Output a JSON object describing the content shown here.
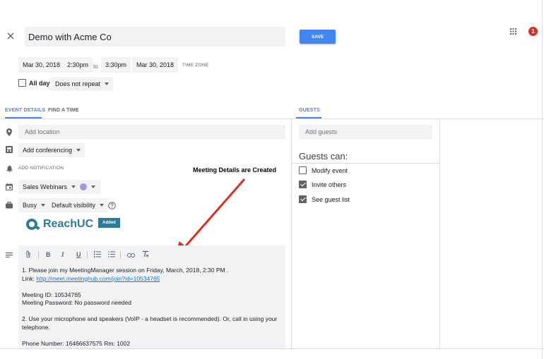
{
  "header": {
    "title": "Demo with Acme Co",
    "save_label": "SAVE",
    "notification_count": "1"
  },
  "datetime": {
    "start_date": "Mar 30, 2018",
    "start_time": "2:30pm",
    "to_label": "to",
    "end_time": "3:30pm",
    "end_date": "Mar 30, 2018",
    "timezone_label": "TIME ZONE",
    "all_day_label": "All day",
    "repeat_value": "Does not repeat"
  },
  "tabs": {
    "event_details": "EVENT DETAILS",
    "find_a_time": "FIND A TIME",
    "guests": "GUESTS"
  },
  "details": {
    "location_placeholder": "Add location",
    "conferencing_label": "Add conferencing",
    "add_notification_label": "ADD NOTIFICATION",
    "calendar_value": "Sales Webinars",
    "color_value": "#a995de",
    "busy_value": "Busy",
    "visibility_value": "Default visibility",
    "addon_name": "ReachUC",
    "addon_status": "Added"
  },
  "annotation": {
    "text": "Meeting Details are Created",
    "arrow_color": "#d93025"
  },
  "description": {
    "line1": "1. Please join my MeetingManager session on Friday, March, 2018, 2:30 PM .",
    "link_label": "Link: ",
    "link_url": "http://meet.meetinghub.com/join?id=10534765",
    "meeting_id": "Meeting ID: 10534765",
    "meeting_password": "Meeting Password: No password needed",
    "line2": "2. Use your microphone and speakers (VoIP - a headset is recommended). Or, call in using your telephone.",
    "phone": "Phone Number: 16466637575 Rm: 1002"
  },
  "guests": {
    "add_placeholder": "Add guests",
    "guests_can_label": "Guests can:",
    "permissions": [
      {
        "label": "Modify event",
        "checked": false
      },
      {
        "label": "Invite others",
        "checked": true
      },
      {
        "label": "See guest list",
        "checked": true
      }
    ]
  },
  "colors": {
    "accent": "#4285f4",
    "badge": "#d93025",
    "addon_teal": "#2b7a9b"
  },
  "icons": {
    "close": "close-icon",
    "apps": "apps-grid-icon",
    "location": "location-pin-icon",
    "conferencing": "video-conference-icon",
    "notification": "bell-icon",
    "calendar": "calendar-icon",
    "busy": "briefcase-icon",
    "help": "help-icon",
    "description": "notes-icon"
  }
}
